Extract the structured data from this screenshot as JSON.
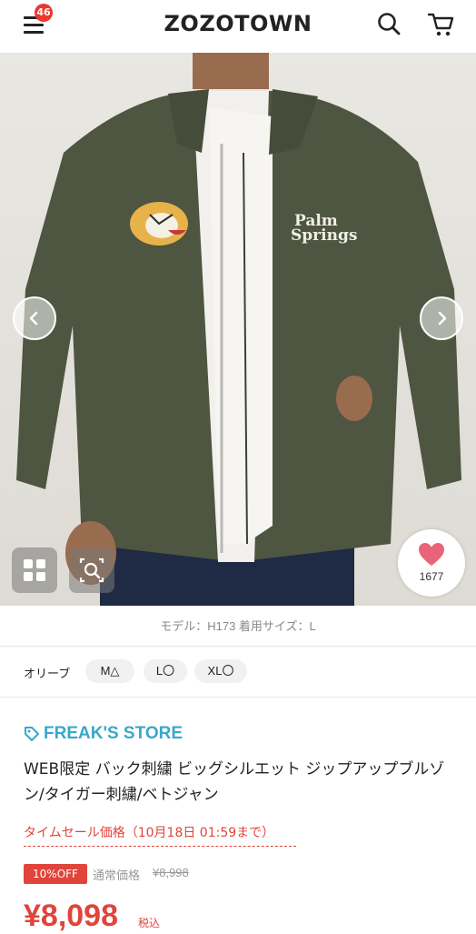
{
  "header": {
    "logo": "ZOZOTOWN",
    "menu_badge": "46",
    "icons": [
      "menu-icon",
      "search-icon",
      "cart-icon"
    ]
  },
  "product_image": {
    "description_icon": "jacket-photo",
    "palm_text": "Palm Springs",
    "favorite_count": "1677"
  },
  "model_info": "モデル：H173 着用サイズ：L",
  "variant": {
    "color": "オリーブ",
    "sizes": [
      "M△",
      "L〇",
      "XL〇"
    ]
  },
  "product": {
    "store": "FREAK'S STORE",
    "title": "WEB限定 バック刺繍 ビッグシルエット ジップアップブルゾン/タイガー刺繍/ベトジャン",
    "sale_label": "タイムセール価格（10月18日 01:59まで）",
    "discount_badge": "10%OFF",
    "regular_label": "通常価格",
    "regular_price": "¥8,998",
    "price": "¥8,098",
    "tax_label": "税込"
  },
  "colors": {
    "accent_red": "#e0443b",
    "store_blue": "#3aa7c9",
    "heart_pink": "#e8647a"
  }
}
